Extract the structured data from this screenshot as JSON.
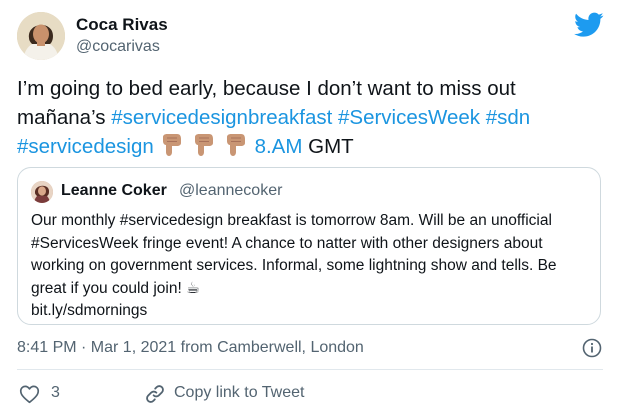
{
  "author": {
    "name": "Coca Rivas",
    "handle": "@cocarivas"
  },
  "tweet": {
    "line1": "I’m going to bed early, because I don’t want to miss out",
    "line2_prefix": "mañana’s ",
    "tag1": "#servicedesignbreakfast",
    "tag2": "#ServicesWeek",
    "tag3": "#sdn",
    "tag4": "#servicedesign",
    "time_link": "8.AM",
    "suffix": " GMT"
  },
  "quoted": {
    "name": "Leanne Coker",
    "handle": "@leannecoker",
    "text": "Our monthly #servicedesign breakfast is tomorrow 8am. Will be an unofficial #ServicesWeek fringe event! A chance to natter with other designers about working on government services. Informal, some lightning show and tells. Be great if you could join! ☕",
    "link": "bit.ly/sdmornings"
  },
  "meta": {
    "timestamp": "8:41 PM · Mar 1, 2021 from Camberwell, London"
  },
  "actions": {
    "like_count": "3",
    "copy_link_label": "Copy link to Tweet"
  },
  "colors": {
    "link": "#1b95e0",
    "brand": "#1d9bf0",
    "secondary_text": "#536471",
    "divider": "#e1e8ed"
  },
  "icons": [
    "twitter-bird",
    "pointing-down-hand",
    "info-circle",
    "heart-outline",
    "chain-link"
  ]
}
